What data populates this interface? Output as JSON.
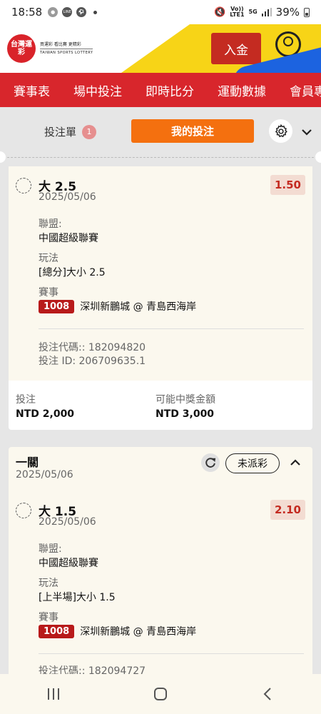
{
  "status_bar": {
    "time": "18:58",
    "icon_line": "LINE",
    "battery": "39%",
    "volte": "Vo))",
    "lte": "LTE1",
    "net": "5G"
  },
  "header": {
    "logo_text": "台灣運彩",
    "logo_tagline": "買運彩 看比賽 更精彩",
    "logo_en": "TAIWAN SPORTS LOTTERY",
    "deposit_label": "入金"
  },
  "nav": {
    "items": [
      "賽事表",
      "場中投注",
      "即時比分",
      "運動數據",
      "會員專"
    ]
  },
  "tabs": {
    "betslip_label": "投注單",
    "betslip_count": "1",
    "mybets_label": "我的投注"
  },
  "bet1": {
    "selection": "大 2.5",
    "date": "2025/05/06",
    "odds": "1.50",
    "league_label": "聯盟:",
    "league": "中國超級聯賽",
    "market_label": "玩法",
    "market": "[總分]大小 2.5",
    "event_label": "賽事",
    "match_code": "1008",
    "match": "深圳新鵬城 @ 青島西海岸",
    "bet_code": "投注代碼:: 182094820",
    "bet_id": "投注 ID: 206709635.1",
    "stake_label": "投注",
    "stake": "NTD 2,000",
    "payout_label": "可能中獎金額",
    "payout": "NTD 3,000"
  },
  "bet2": {
    "type": "一關",
    "date": "2025/05/06",
    "status": "未派彩",
    "selection": "大 1.5",
    "sel_date": "2025/05/06",
    "odds": "2.10",
    "league_label": "聯盟:",
    "league": "中國超級聯賽",
    "market_label": "玩法",
    "market": "[上半場]大小 1.5",
    "event_label": "賽事",
    "match_code": "1008",
    "match": "深圳新鵬城 @ 青島西海岸",
    "bet_code": "投注代碼:: 182094727"
  },
  "colors": {
    "brand_red": "#d8262c",
    "orange": "#f4700f",
    "yellow": "#f7d417",
    "card_bg": "#fbf8ee"
  }
}
